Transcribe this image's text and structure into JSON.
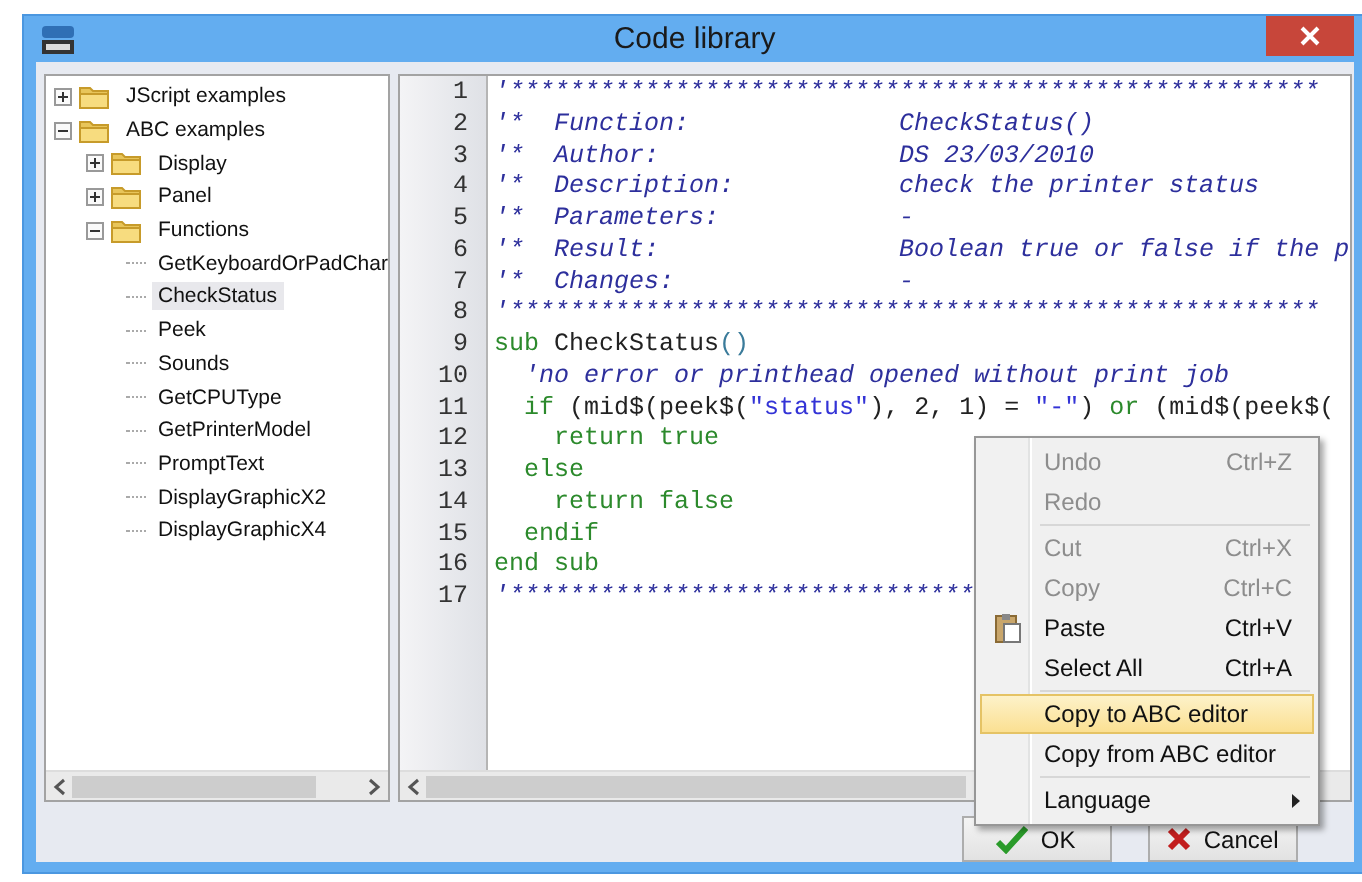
{
  "window": {
    "title": "Code library"
  },
  "tree": [
    {
      "kind": "folder",
      "label": "JScript examples",
      "expanded": false,
      "selected": false
    },
    {
      "kind": "folder",
      "label": "ABC examples",
      "expanded": true,
      "selected": false,
      "children": [
        {
          "kind": "folder",
          "label": "Display",
          "expanded": false,
          "selected": false
        },
        {
          "kind": "folder",
          "label": "Panel",
          "expanded": false,
          "selected": false
        },
        {
          "kind": "folder",
          "label": "Functions",
          "expanded": true,
          "selected": false,
          "children": [
            {
              "kind": "leaf",
              "label": "GetKeyboardOrPadChar",
              "selected": false
            },
            {
              "kind": "leaf",
              "label": "CheckStatus",
              "selected": true
            },
            {
              "kind": "leaf",
              "label": "Peek",
              "selected": false
            },
            {
              "kind": "leaf",
              "label": "Sounds",
              "selected": false
            },
            {
              "kind": "leaf",
              "label": "GetCPUType",
              "selected": false
            },
            {
              "kind": "leaf",
              "label": "GetPrinterModel",
              "selected": false
            },
            {
              "kind": "leaf",
              "label": "PromptText",
              "selected": false
            },
            {
              "kind": "leaf",
              "label": "DisplayGraphicX2",
              "selected": false
            },
            {
              "kind": "leaf",
              "label": "DisplayGraphicX4",
              "selected": false
            }
          ]
        }
      ]
    }
  ],
  "editor": {
    "lines": [
      {
        "number": "1",
        "segments": [
          {
            "kind": "comment",
            "text": "'******************************************************"
          }
        ]
      },
      {
        "number": "2",
        "segments": [
          {
            "kind": "comment",
            "text": "'*  Function:              CheckStatus()"
          }
        ]
      },
      {
        "number": "3",
        "segments": [
          {
            "kind": "comment",
            "text": "'*  Author:                DS 23/03/2010"
          }
        ]
      },
      {
        "number": "4",
        "segments": [
          {
            "kind": "comment",
            "text": "'*  Description:           check the printer status"
          }
        ]
      },
      {
        "number": "5",
        "segments": [
          {
            "kind": "comment",
            "text": "'*  Parameters:            -"
          }
        ]
      },
      {
        "number": "6",
        "segments": [
          {
            "kind": "comment",
            "text": "'*  Result:                Boolean true or false if the p"
          }
        ]
      },
      {
        "number": "7",
        "segments": [
          {
            "kind": "comment",
            "text": "'*  Changes:               -"
          }
        ]
      },
      {
        "number": "8",
        "segments": [
          {
            "kind": "comment",
            "text": "'******************************************************"
          }
        ]
      },
      {
        "number": "9",
        "segments": [
          {
            "kind": "keyword",
            "text": "sub"
          },
          {
            "kind": "plain",
            "text": " CheckStatus"
          },
          {
            "kind": "punct",
            "text": "()"
          }
        ]
      },
      {
        "number": "10",
        "segments": [
          {
            "kind": "comment",
            "text": "  'no error or printhead opened without print job"
          }
        ]
      },
      {
        "number": "11",
        "segments": [
          {
            "kind": "keyword",
            "text": "  if"
          },
          {
            "kind": "plain",
            "text": " (mid$(peek$("
          },
          {
            "kind": "string",
            "text": "\"status\""
          },
          {
            "kind": "plain",
            "text": "), 2, 1) = "
          },
          {
            "kind": "string",
            "text": "\"-\""
          },
          {
            "kind": "plain",
            "text": ") "
          },
          {
            "kind": "keyword",
            "text": "or"
          },
          {
            "kind": "plain",
            "text": " (mid$(peek$("
          }
        ]
      },
      {
        "number": "12",
        "segments": [
          {
            "kind": "keyword",
            "text": "    return true"
          }
        ]
      },
      {
        "number": "13",
        "segments": [
          {
            "kind": "keyword",
            "text": "  else"
          }
        ]
      },
      {
        "number": "14",
        "segments": [
          {
            "kind": "keyword",
            "text": "    return false"
          }
        ]
      },
      {
        "number": "15",
        "segments": [
          {
            "kind": "keyword",
            "text": "  endif"
          }
        ]
      },
      {
        "number": "16",
        "segments": [
          {
            "kind": "keyword",
            "text": "end sub"
          }
        ]
      },
      {
        "number": "17",
        "segments": [
          {
            "kind": "comment",
            "text": "'*******************************"
          }
        ]
      }
    ]
  },
  "context_menu": {
    "items": [
      {
        "kind": "item",
        "label": "Undo",
        "shortcut": "Ctrl+Z",
        "disabled": true,
        "selected": false
      },
      {
        "kind": "item",
        "label": "Redo",
        "disabled": true,
        "selected": false
      },
      {
        "kind": "separator"
      },
      {
        "kind": "item",
        "label": "Cut",
        "shortcut": "Ctrl+X",
        "disabled": true,
        "selected": false
      },
      {
        "kind": "item",
        "label": "Copy",
        "shortcut": "Ctrl+C",
        "disabled": true,
        "selected": false
      },
      {
        "kind": "icon_item",
        "label": "Paste",
        "shortcut": "Ctrl+V",
        "disabled": false,
        "selected": false
      },
      {
        "kind": "item",
        "label": "Select All",
        "shortcut": "Ctrl+A",
        "disabled": false,
        "selected": false
      },
      {
        "kind": "separator"
      },
      {
        "kind": "item",
        "label": "Copy to ABC editor",
        "disabled": false,
        "selected": true
      },
      {
        "kind": "item",
        "label": "Copy from ABC editor",
        "disabled": false,
        "selected": false
      },
      {
        "kind": "separator"
      },
      {
        "kind": "submenu",
        "label": "Language",
        "disabled": false,
        "selected": false
      }
    ]
  },
  "buttons": [
    {
      "kind": "ok",
      "label": "OK"
    },
    {
      "kind": "cancel",
      "label": "Cancel"
    }
  ]
}
